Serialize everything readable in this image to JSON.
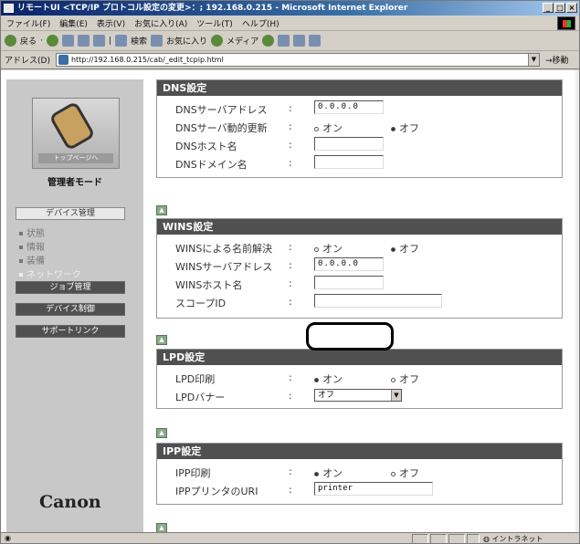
{
  "window": {
    "title": "リモートUI <TCP/IP プロトコル設定の変更>：; 192.168.0.215 - Microsoft Internet Explorer"
  },
  "menu": [
    "ファイル(F)",
    "編集(E)",
    "表示(V)",
    "お気に入り(A)",
    "ツール(T)",
    "ヘルプ(H)"
  ],
  "toolbar": {
    "back": "戻る",
    "search": "検索",
    "favorites": "お気に入り",
    "media": "メディア"
  },
  "address": {
    "label": "アドレス(D)",
    "url": "http://192.168.0.215/cab/_edit_tcpip.html",
    "go": "移動"
  },
  "sidebar": {
    "logo_label": "トップページへ",
    "mode": "管理者モード",
    "device_mgmt": "デバイス管理",
    "sub_items": [
      "状態",
      "情報",
      "装備",
      "ネットワーク"
    ],
    "job_mgmt": "ジョブ管理",
    "device_control": "デバイス制御",
    "support_link": "サポートリンク",
    "brand": "Canon"
  },
  "dns": {
    "title": "DNS設定",
    "server_label": "DNSサーバアドレス",
    "server_value": "0.0.0.0",
    "dynamic_label": "DNSサーバ動的更新",
    "on": "オン",
    "off": "オフ",
    "host_label": "DNSホスト名",
    "domain_label": "DNSドメイン名"
  },
  "wins": {
    "title": "WINS設定",
    "resolve_label": "WINSによる名前解決",
    "on": "オン",
    "off": "オフ",
    "server_label": "WINSサーバアドレス",
    "server_value": "0.0.0.0",
    "host_label": "WINSホスト名",
    "scope_label": "スコープID"
  },
  "lpd": {
    "title": "LPD設定",
    "print_label": "LPD印刷",
    "on": "オン",
    "off": "オフ",
    "banner_label": "LPDバナー",
    "banner_value": "オフ"
  },
  "ipp": {
    "title": "IPP設定",
    "print_label": "IPP印刷",
    "on": "オン",
    "off": "オフ",
    "uri_label": "IPPプリンタのURI",
    "uri_value": "printer"
  },
  "status": {
    "zone": "イントラネット"
  },
  "colors": {
    "section_header": "#505050",
    "title_bar": "#0a246a"
  }
}
